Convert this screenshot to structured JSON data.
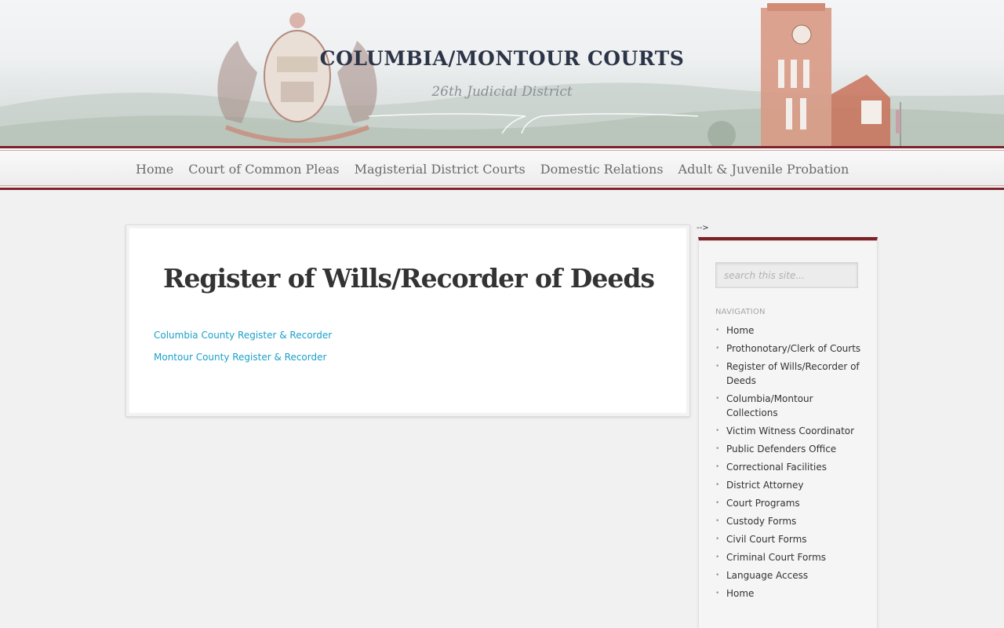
{
  "header": {
    "title": "COLUMBIA/MONTOUR COURTS",
    "subtitle": "26th Judicial District"
  },
  "topnav": {
    "items": [
      {
        "label": "Home"
      },
      {
        "label": "Court of Common Pleas"
      },
      {
        "label": "Magisterial District Courts"
      },
      {
        "label": "Domestic Relations"
      },
      {
        "label": "Adult & Juvenile Probation"
      }
    ]
  },
  "main": {
    "title": "Register of Wills/Recorder of Deeds",
    "links": [
      {
        "label": "Columbia County Register & Recorder"
      },
      {
        "label": "Montour County Register & Recorder"
      }
    ]
  },
  "stray_text": "-->",
  "sidebar": {
    "search_placeholder": "search this site...",
    "nav_heading": "NAVIGATION",
    "items": [
      {
        "label": "Home"
      },
      {
        "label": "Prothonotary/Clerk of Courts"
      },
      {
        "label": "Register of Wills/Recorder of Deeds"
      },
      {
        "label": "Columbia/Montour Collections"
      },
      {
        "label": "Victim Witness Coordinator"
      },
      {
        "label": "Public Defenders Office"
      },
      {
        "label": "Correctional Facilities"
      },
      {
        "label": "District Attorney"
      },
      {
        "label": "Court Programs"
      },
      {
        "label": "Custody Forms"
      },
      {
        "label": "Civil Court Forms"
      },
      {
        "label": "Criminal Court Forms"
      },
      {
        "label": "Language Access"
      },
      {
        "label": "Home"
      }
    ]
  },
  "colors": {
    "accent": "#7d2229",
    "link": "#1aa0c9",
    "title": "#2c3448"
  }
}
